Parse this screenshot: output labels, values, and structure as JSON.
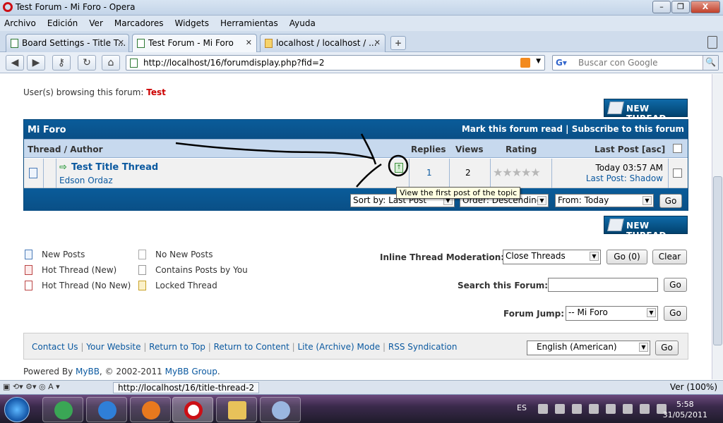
{
  "window": {
    "title": "Test Forum - Mi Foro - Opera",
    "controls": [
      "–",
      "❐",
      "X"
    ]
  },
  "menu": [
    "Archivo",
    "Edición",
    "Ver",
    "Marcadores",
    "Widgets",
    "Herramientas",
    "Ayuda"
  ],
  "tabs": [
    {
      "label": "Board Settings - Title T...",
      "active": false
    },
    {
      "label": "Test Forum - Mi Foro",
      "active": true
    },
    {
      "label": "localhost / localhost / ...",
      "active": false
    }
  ],
  "address": {
    "url": "http://localhost/16/forumdisplay.php?fid=2",
    "search_placeholder": "Buscar con Google"
  },
  "forum": {
    "browsing_label": "User(s) browsing this forum:",
    "browsing_user": "Test",
    "new_thread_label": "NEW THREAD",
    "name": "Mi Foro",
    "header_links": "Mark this forum read | Subscribe to this forum",
    "columns": {
      "thread": "Thread / Author",
      "replies": "Replies",
      "views": "Views",
      "rating": "Rating",
      "lastpost": "Last Post [asc]"
    },
    "threads": [
      {
        "title": "Test Title Thread",
        "author": "Edson Ordaz",
        "replies": "1",
        "views": "2",
        "rating_stars": 0,
        "last_time": "Today 03:57 AM",
        "last_label": "Last Post:",
        "last_user": "Shadow"
      }
    ],
    "tooltip": "View the first post of the topic",
    "sort": {
      "sort_by": "Sort by: Last Post",
      "order": "Order: Descending",
      "from": "From: Today",
      "go": "Go"
    }
  },
  "legend": [
    "New Posts",
    "Hot Thread (New)",
    "Hot Thread (No New)",
    "No New Posts",
    "Contains Posts by You",
    "Locked Thread"
  ],
  "moderation": {
    "label": "Inline Thread Moderation:",
    "selected": "Close Threads",
    "go": "Go (0)",
    "clear": "Clear"
  },
  "search": {
    "label": "Search this Forum:",
    "go": "Go"
  },
  "jump": {
    "label": "Forum Jump:",
    "selected": "-- Mi Foro",
    "go": "Go"
  },
  "footer": {
    "links": [
      "Contact Us",
      "Your Website",
      "Return to Top",
      "Return to Content",
      "Lite (Archive) Mode",
      "RSS Syndication"
    ],
    "language": "English (American)",
    "go": "Go",
    "powered_prefix": "Powered By",
    "powered_mybb": "MyBB",
    "powered_mid": ", © 2002-2011",
    "powered_group": "MyBB Group",
    "powered_suffix": "."
  },
  "statusbar": {
    "url": "http://localhost/16/title-thread-2",
    "zoom": "Ver (100%)"
  },
  "taskbar": {
    "lang": "ES",
    "time": "5:58",
    "date": "31/05/2011"
  }
}
